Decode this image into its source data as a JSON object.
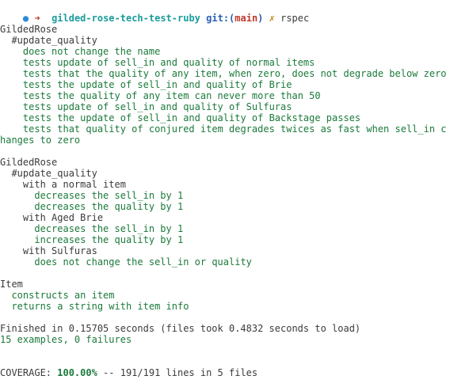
{
  "prompt": {
    "dot": "●",
    "arrow": "➜",
    "directory": "gilded-rose-tech-test-ruby",
    "git_label": "git:(",
    "branch": "main",
    "git_close": ")",
    "dirty_marker": "✗",
    "command": "rspec"
  },
  "block1": {
    "describe": "GildedRose",
    "context": "#update_quality",
    "examples": [
      "does not change the name",
      "tests update of sell_in and quality of normal items",
      "tests that the quality of any item, when zero, does not degrade below zero",
      "tests the update of sell_in and quality of Brie",
      "tests the quality of any item can never more than 50",
      "tests update of sell_in and quality of Sulfuras",
      "tests the update of sell_in and quality of Backstage passes",
      "tests that quality of conjured item degrades twices as fast when sell_in c",
      "hanges to zero"
    ]
  },
  "block2": {
    "describe": "GildedRose",
    "context": "#update_quality",
    "groups": [
      {
        "label": "with a normal item",
        "examples": [
          "decreases the sell_in by 1",
          "decreases the quality by 1"
        ]
      },
      {
        "label": "with Aged Brie",
        "examples": [
          "decreases the sell_in by 1",
          "increases the quality by 1"
        ]
      },
      {
        "label": "with Sulfuras",
        "examples": [
          "does not change the sell_in or quality"
        ]
      }
    ]
  },
  "block3": {
    "describe": "Item",
    "examples": [
      "constructs an item",
      "returns a string with item info"
    ]
  },
  "summary": {
    "finished": "Finished in 0.15705 seconds (files took 0.4832 seconds to load)",
    "result": "15 examples, 0 failures"
  },
  "coverage": {
    "label": "COVERAGE: ",
    "percent": "100.00%",
    "detail": " -- 191/191 lines in 5 files"
  },
  "colors": {
    "pass_green": "#1b7a3b",
    "text": "#3b3b3b",
    "prompt_dir": "#1b9b9b",
    "git_label": "#2b5fb3",
    "branch": "#c0392b",
    "dot": "#2b8ad8"
  }
}
